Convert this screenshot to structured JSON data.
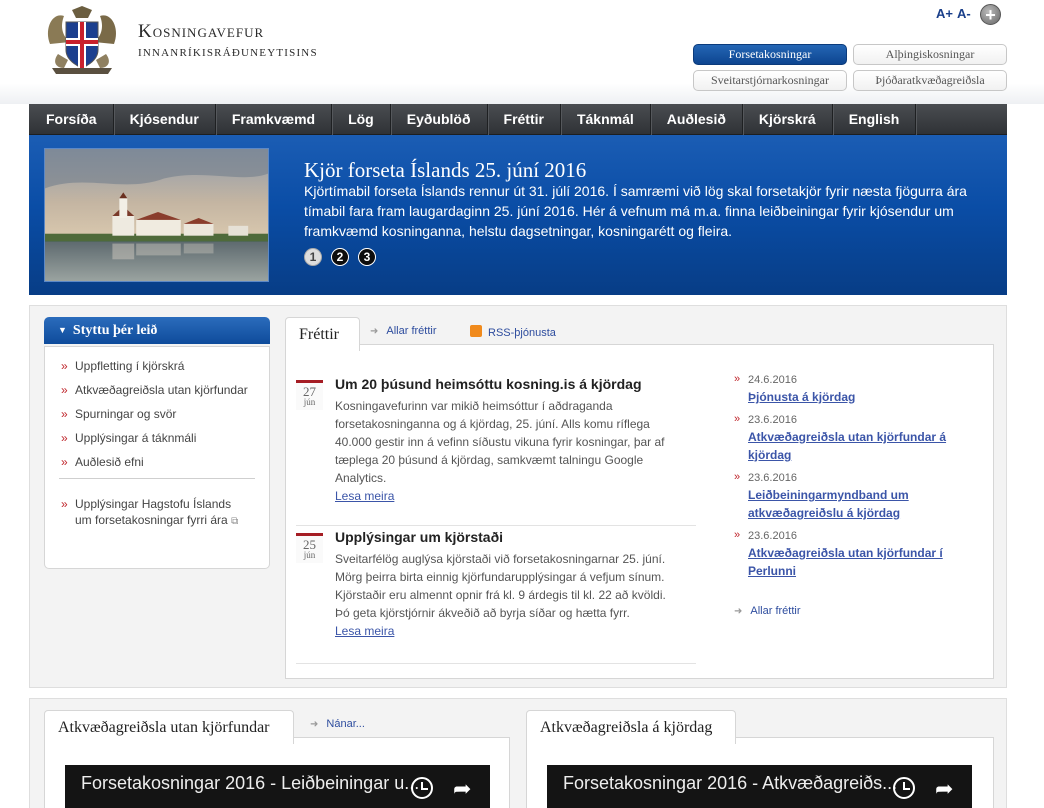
{
  "header": {
    "title_line1": "Kosningavefur",
    "title_line2": "innanríkisráðuneytisins",
    "font_increase": "A+",
    "font_decrease": "A-",
    "election_tabs": [
      {
        "label": "Forsetakosningar",
        "active": true
      },
      {
        "label": "Alþingiskosningar",
        "active": false
      },
      {
        "label": "Sveitarstjórnarkosningar",
        "active": false
      },
      {
        "label": "Þjóðaratkvæðagreiðsla",
        "active": false
      }
    ]
  },
  "nav": {
    "items": [
      "Forsíða",
      "Kjósendur",
      "Framkvæmd",
      "Lög",
      "Eyðublöð",
      "Fréttir",
      "Táknmál",
      "Auðlesið",
      "Kjörskrá",
      "English"
    ]
  },
  "hero": {
    "title": "Kjör forseta Íslands 25. júní 2016",
    "text": "Kjörtímabil forseta Íslands rennur út 31. júlí 2016. Í samræmi við lög skal forsetakjör fyrir næsta fjögurra ára tímabil fara fram laugardaginn 25. júní 2016. Hér á vefnum má m.a. finna leiðbeiningar fyrir kjósendur um framkvæmd kosninganna, helstu dagsetningar, kosningarétt og fleira.",
    "slides": [
      "1",
      "2",
      "3"
    ]
  },
  "shortcuts": {
    "title": "Styttu þér leið",
    "items": [
      "Uppfletting í kjörskrá",
      "Atkvæðagreiðsla utan kjörfundar",
      "Spurningar og svör",
      "Upplýsingar á táknmáli",
      "Auðlesið efni"
    ],
    "extra": "Upplýsingar Hagstofu Íslands um forsetakosningar fyrri ára"
  },
  "news": {
    "tab": "Fréttir",
    "all_link": "Allar fréttir",
    "rss_link": "RSS-þjónusta",
    "articles": [
      {
        "day": "27",
        "month": "jún",
        "title": "Um 20 þúsund heimsóttu kosning.is á kjördag",
        "body": "Kosningavefurinn var mikið heimsóttur í aðdraganda forsetakosninganna og á kjördag, 25. júní. Alls komu ríflega 40.000 gestir inn á vefinn síðustu vikuna fyrir kosningar, þar af tæplega 20 þúsund á kjördag, samkvæmt talningu Google Analytics.",
        "more": "Lesa meira"
      },
      {
        "day": "25",
        "month": "jún",
        "title": "Upplýsingar um kjörstaði",
        "body": "Sveitarfélög auglýsa kjörstaði við forsetakosningarnar 25. júní. Mörg þeirra birta einnig kjörfundarupplýsingar á vefjum sínum. Kjörstaðir eru almennt opnir frá kl. 9 árdegis til kl. 22 að kvöldi. Þó geta kjörstjórnir ákveðið að byrja síðar og hætta fyrr.",
        "more": "Lesa meira"
      }
    ],
    "side": [
      {
        "date": "24.6.2016",
        "title": "Þjónusta á kjördag"
      },
      {
        "date": "23.6.2016",
        "title": "Atkvæðagreiðsla utan kjörfundar á kjördag"
      },
      {
        "date": "23.6.2016",
        "title": "Leiðbeiningarmyndband um atkvæðagreiðslu á kjördag"
      },
      {
        "date": "23.6.2016",
        "title": "Atkvæðagreiðsla utan kjörfundar í Perlunni"
      }
    ],
    "side_all": "Allar fréttir"
  },
  "bottom": {
    "left_tab": "Atkvæðagreiðsla utan kjörfundar",
    "left_more": "Nánar...",
    "left_video_title": "Forsetakosningar 2016 - Leiðbeiningar u...",
    "right_tab": "Atkvæðagreiðsla á kjördag",
    "right_video_title": "Forsetakosningar 2016 - Atkvæðagreiðs..."
  },
  "colors": {
    "brand_blue": "#0a4da6",
    "nav_dark": "#3a3d41",
    "accent_red": "#c0272d",
    "link_blue": "#3b55a8"
  }
}
